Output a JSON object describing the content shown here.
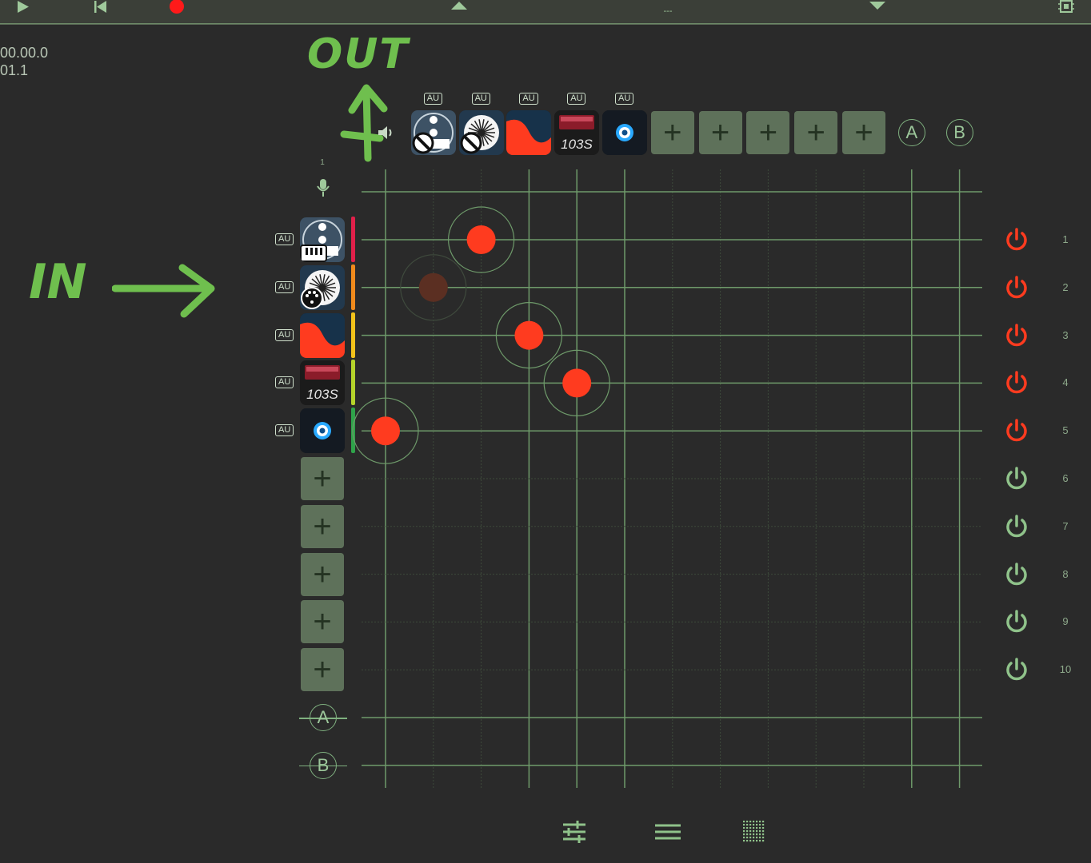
{
  "transport": {
    "play_icon": "play-icon",
    "rewind_icon": "skip-to-start-icon",
    "record_icon": "record-icon",
    "center_label": "---",
    "settings_icon": "chip-icon"
  },
  "timecode": {
    "time": "00.00.0",
    "bar": "01.1"
  },
  "annotations": {
    "out": "OUT",
    "in": "IN"
  },
  "outputs": {
    "speaker_icon": "speaker-icon",
    "plugins": [
      {
        "badge": "AU",
        "name": "midi-tool-icon",
        "label": ""
      },
      {
        "badge": "AU",
        "name": "radial-synth-icon",
        "label": ""
      },
      {
        "badge": "AU",
        "name": "red-wave-icon",
        "label": ""
      },
      {
        "badge": "AU",
        "name": "103s-synth-icon",
        "label": "103S"
      },
      {
        "badge": "AU",
        "name": "blue-ring-icon",
        "label": ""
      }
    ],
    "add_slots": [
      "+",
      "+",
      "+",
      "+",
      "+"
    ],
    "buses": [
      "A",
      "B"
    ]
  },
  "inputs": {
    "mic_channel": "1",
    "mic_icon": "microphone-icon",
    "plugins": [
      {
        "badge": "AU",
        "name": "midi-tool-icon",
        "label": "",
        "strip_color": "#e0204a"
      },
      {
        "badge": "AU",
        "name": "radial-synth-icon",
        "label": "",
        "strip_color": "#f08a1c"
      },
      {
        "badge": "AU",
        "name": "red-wave-icon",
        "label": "",
        "strip_color": "#f2c21a"
      },
      {
        "badge": "AU",
        "name": "103s-synth-icon",
        "label": "103S",
        "strip_color": "#b5d32a"
      },
      {
        "badge": "AU",
        "name": "blue-ring-icon",
        "label": "",
        "strip_color": "#2fa34a"
      }
    ],
    "add_slots": [
      "+",
      "+",
      "+",
      "+",
      "+"
    ],
    "buses": [
      "A",
      "B"
    ]
  },
  "rows": [
    {
      "num": "1",
      "power": "on"
    },
    {
      "num": "2",
      "power": "on"
    },
    {
      "num": "3",
      "power": "on"
    },
    {
      "num": "4",
      "power": "on"
    },
    {
      "num": "5",
      "power": "on"
    },
    {
      "num": "6",
      "power": "off"
    },
    {
      "num": "7",
      "power": "off"
    },
    {
      "num": "8",
      "power": "off"
    },
    {
      "num": "9",
      "power": "off"
    },
    {
      "num": "10",
      "power": "off"
    }
  ],
  "connections": [
    {
      "input": 1,
      "output": 3,
      "active": true
    },
    {
      "input": 2,
      "output": 2,
      "active": false
    },
    {
      "input": 3,
      "output": 4,
      "active": true
    },
    {
      "input": 4,
      "output": 5,
      "active": true
    },
    {
      "input": 5,
      "output": 1,
      "active": true
    }
  ],
  "bottom_toolbar": [
    "mixer-sliders-icon",
    "menu-lines-icon",
    "grid-dots-icon"
  ],
  "colors": {
    "background": "#2a2a2a",
    "accent_green": "#7fb07f",
    "node_red": "#ff3b1f",
    "power_on": "#ff3b1f",
    "power_off": "#8fc28a"
  }
}
